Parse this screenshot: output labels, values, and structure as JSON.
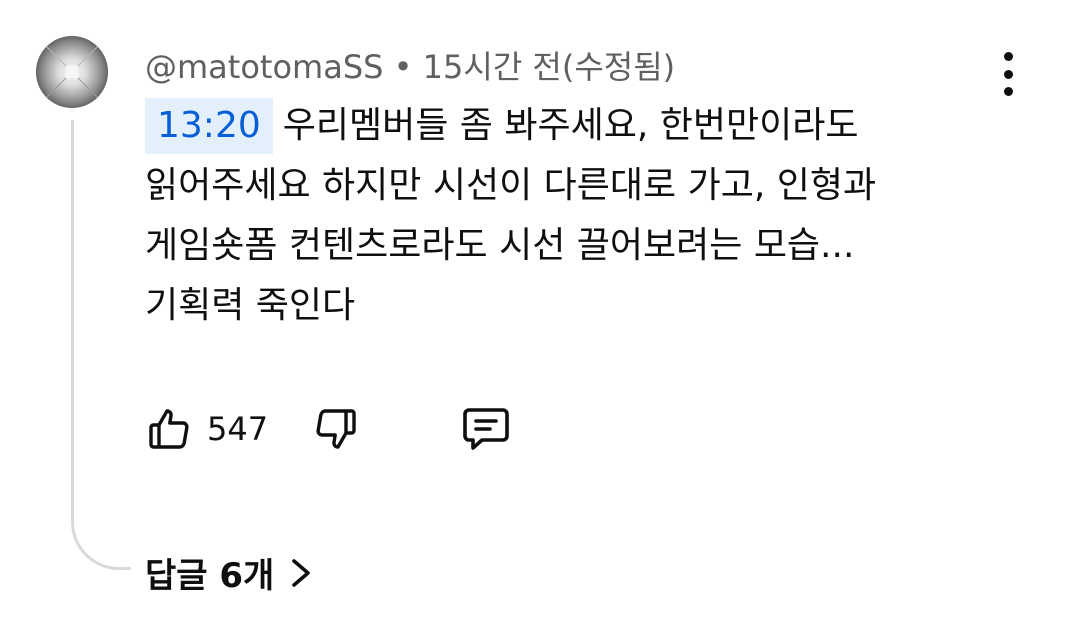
{
  "comment": {
    "author": "@matotomaSS",
    "separator": "•",
    "time": "15시간 전(수정됨)",
    "timestamp_link": "13:20",
    "text_line1": "우리멤버들 좀 봐주세요, 한번만이라도",
    "text_line2": "읽어주세요 하지만 시선이 다른대로 가고, 인형과",
    "text_line3": "게임숏폼 컨텐츠로라도 시선 끌어보려는 모습...",
    "text_line4": "기획력 죽인다",
    "like_count": "547",
    "replies_label": "답글 6개"
  },
  "icons": {
    "like": "thumbs-up-icon",
    "dislike": "thumbs-down-icon",
    "reply": "comment-icon",
    "more": "more-vertical-icon",
    "expand": "chevron-right-icon"
  },
  "colors": {
    "timestamp_text": "#065fd4",
    "timestamp_bg": "#e3f0fc",
    "meta_text": "#606060",
    "primary_text": "#0f0f0f",
    "thread_line": "#d9d9d9"
  }
}
